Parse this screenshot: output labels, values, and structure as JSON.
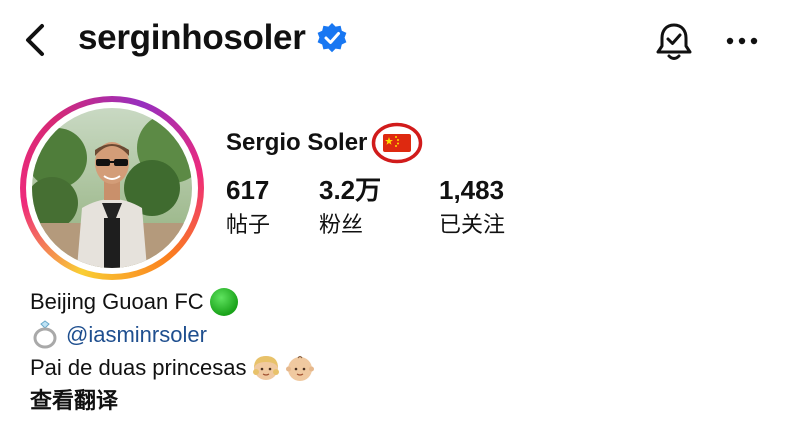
{
  "header": {
    "username": "serginhosoler",
    "icons": {
      "back": "chevron-left-icon",
      "verified": "verified-badge-icon",
      "notifications": "bell-check-icon",
      "more": "more-horizontal-icon"
    }
  },
  "profile": {
    "display_name": "Sergio Soler",
    "flag_emoji": "china-flag",
    "highlight_color": "#d11b1b",
    "stats": {
      "posts": {
        "value": "617",
        "label": "帖子"
      },
      "followers": {
        "value": "3.2万",
        "label": "粉丝"
      },
      "following": {
        "value": "1,483",
        "label": "已关注"
      }
    }
  },
  "bio": {
    "club": "Beijing Guoan FC",
    "mention": "@iasminrsoler",
    "tagline": "Pai de duas princesas",
    "translate_label": "查看翻译"
  },
  "colors": {
    "verified": "#1877f2",
    "mention": "#1f4f8f",
    "text": "#111111"
  }
}
